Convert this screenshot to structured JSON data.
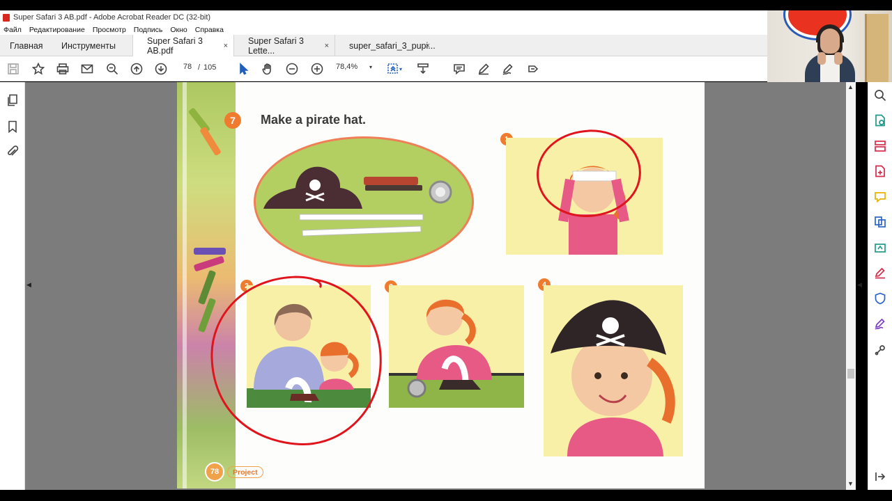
{
  "window": {
    "title": "Super Safari 3 AB.pdf - Adobe Acrobat Reader DC (32-bit)"
  },
  "menu": [
    "Файл",
    "Редактирование",
    "Просмотр",
    "Подпись",
    "Окно",
    "Справка"
  ],
  "tabs": {
    "home": "Главная",
    "tools": "Инструменты",
    "docs": [
      {
        "label": "Super Safari 3 AB.pdf",
        "active": true
      },
      {
        "label": "Super Safari 3 Lette...",
        "active": false
      },
      {
        "label": "super_safari_3_pupi...",
        "active": false
      }
    ],
    "close_glyph": "×"
  },
  "toolbar": {
    "page_current": "78",
    "page_sep": "/",
    "page_total": "105",
    "zoom": "78,4%",
    "zoom_caret": "▾"
  },
  "page": {
    "task_number": "7",
    "task_title": "Make a pirate hat.",
    "steps": [
      "1",
      "2",
      "3",
      "4"
    ],
    "page_number": "78",
    "section_label": "Project"
  },
  "nav": {
    "collapse_left": "◀",
    "collapse_right": "◀",
    "scroll_up": "▲",
    "scroll_down": "▼"
  },
  "colors": {
    "annotation": "#e0141c",
    "accent_orange": "#ef7b2f",
    "right_panel_red": "#d62a4a",
    "right_panel_blue": "#2a63c9",
    "right_panel_teal": "#1f9a8a",
    "right_panel_purple": "#7d3fc3",
    "right_panel_yellow": "#e8b200"
  }
}
